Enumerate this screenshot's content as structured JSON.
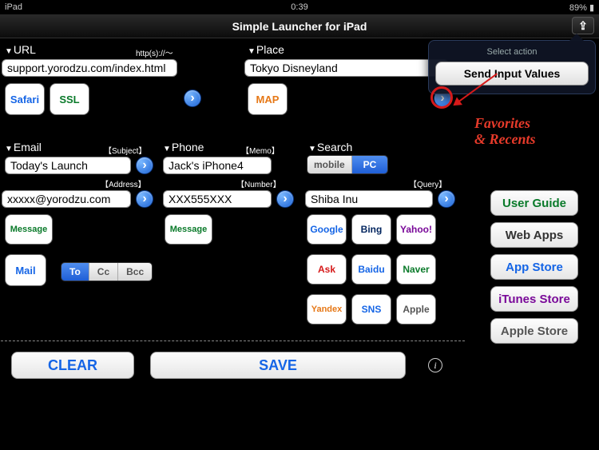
{
  "status": {
    "left": "iPad",
    "center": "0:39",
    "right": "89%"
  },
  "nav": {
    "title": "Simple Launcher for iPad"
  },
  "url": {
    "label": "URL",
    "hint": "http(s)://～",
    "value": "support.yorodzu.com/index.html",
    "safari": "Safari",
    "ssl": "SSL"
  },
  "place": {
    "label": "Place",
    "value": "Tokyo Disneyland",
    "map": "MAP"
  },
  "email": {
    "label": "Email",
    "subject_tag": "【Subject】",
    "subject": "Today's Launch",
    "address_tag": "【Address】",
    "address": "xxxxx@yorodzu.com",
    "message": "Message",
    "mail": "Mail",
    "to": "To",
    "cc": "Cc",
    "bcc": "Bcc"
  },
  "phone": {
    "label": "Phone",
    "memo_tag": "【Memo】",
    "memo": "Jack's iPhone4",
    "number_tag": "【Number】",
    "number": "XXX555XXX",
    "message": "Message"
  },
  "search": {
    "label": "Search",
    "mobile": "mobile",
    "pc": "PC",
    "query_tag": "【Query】",
    "query": "Shiba Inu",
    "engines": {
      "google": "Google",
      "bing": "Bing",
      "yahoo": "Yahoo!",
      "ask": "Ask",
      "baidu": "Baidu",
      "naver": "Naver",
      "yandex": "Yandex",
      "sns": "SNS",
      "apple": "Apple"
    }
  },
  "bottom": {
    "clear": "CLEAR",
    "save": "SAVE"
  },
  "side": {
    "user_guide": "User Guide",
    "web_apps": "Web Apps",
    "app_store": "App Store",
    "itunes": "iTunes Store",
    "apple_store": "Apple Store"
  },
  "popover": {
    "title": "Select action",
    "action": "Send Input Values"
  },
  "anno": {
    "text1": "Favorites",
    "text2": "& Recents"
  }
}
